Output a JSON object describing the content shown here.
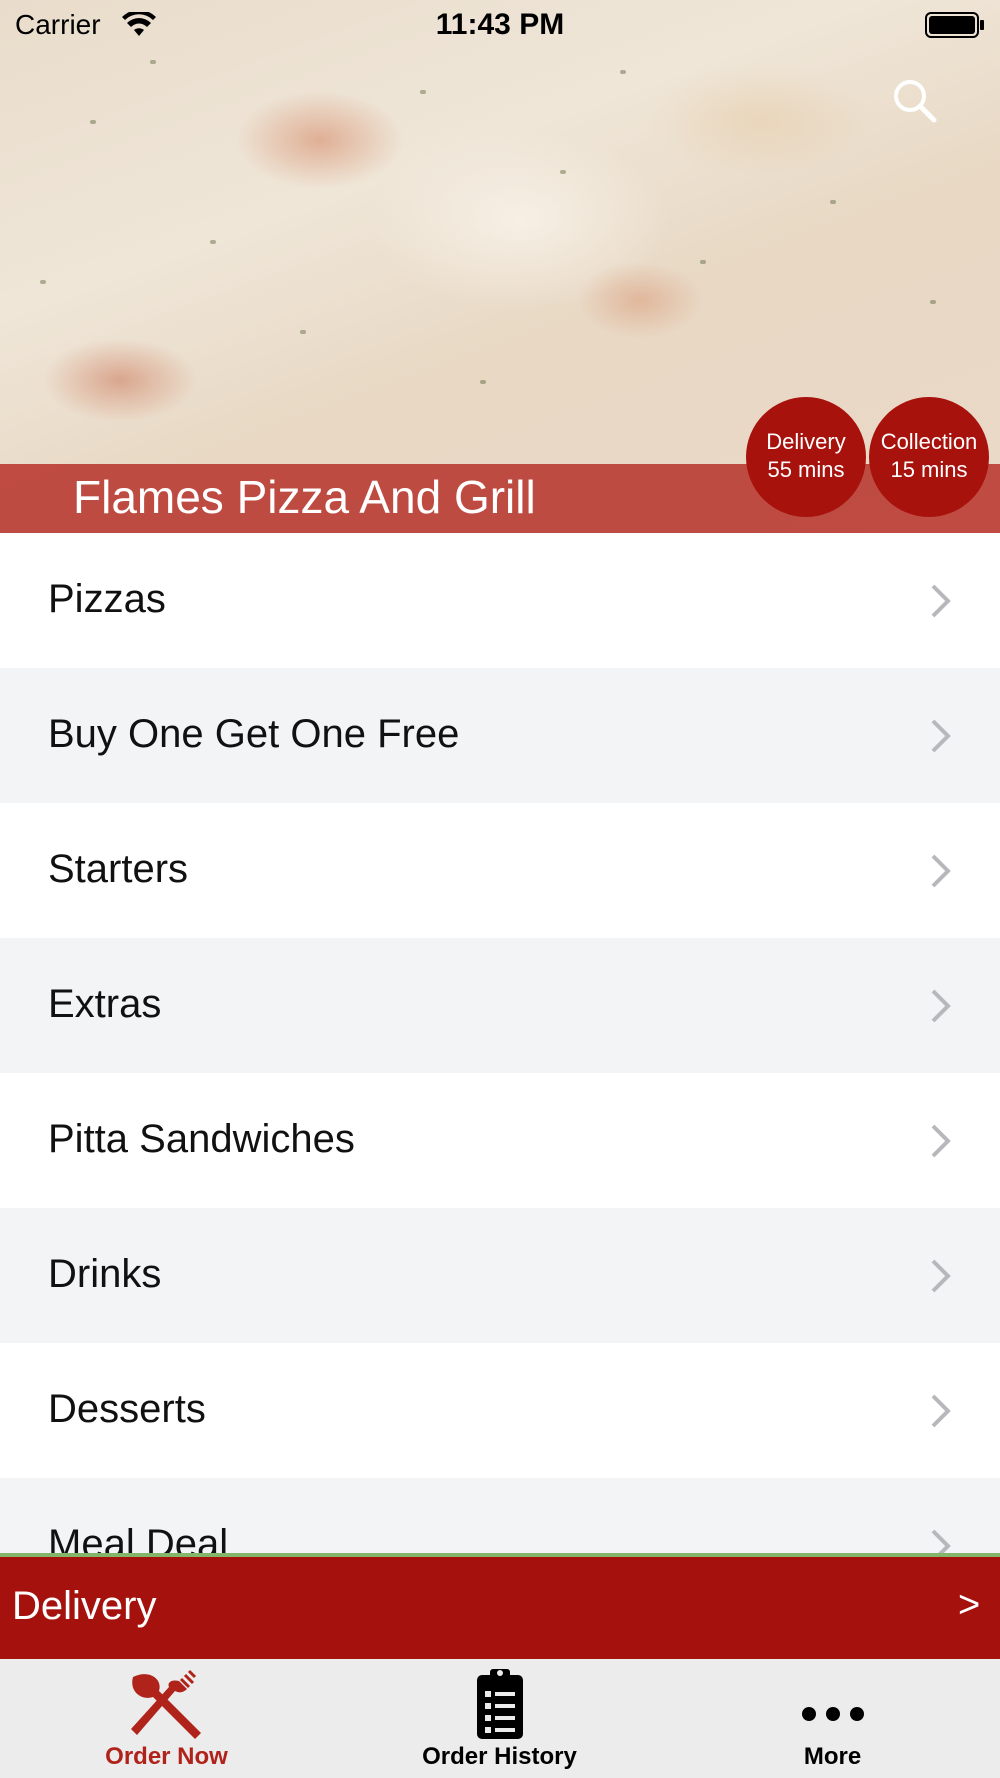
{
  "status_bar": {
    "carrier": "Carrier",
    "time": "11:43 PM"
  },
  "restaurant": {
    "name": "Flames Pizza And Grill"
  },
  "badges": {
    "delivery": {
      "label": "Delivery",
      "time": "55 mins"
    },
    "collection": {
      "label": "Collection",
      "time": "15 mins"
    }
  },
  "menu": {
    "items": [
      {
        "label": "Pizzas"
      },
      {
        "label": "Buy One Get One Free"
      },
      {
        "label": "Starters"
      },
      {
        "label": "Extras"
      },
      {
        "label": "Pitta Sandwiches"
      },
      {
        "label": "Drinks"
      },
      {
        "label": "Desserts"
      },
      {
        "label": "Meal Deal"
      }
    ]
  },
  "order_bar": {
    "label": "Delivery",
    "arrow": ">"
  },
  "tabs": [
    {
      "label": "Order Now",
      "icon": "fork-knife-icon",
      "active": true
    },
    {
      "label": "Order History",
      "icon": "clipboard-icon",
      "active": false
    },
    {
      "label": "More",
      "icon": "more-dots-icon",
      "active": false
    }
  ],
  "colors": {
    "brand_red": "#a5120e",
    "active_tab": "#b0231a",
    "inactive_tab": "#000000",
    "divider_green": "#84b56a"
  }
}
